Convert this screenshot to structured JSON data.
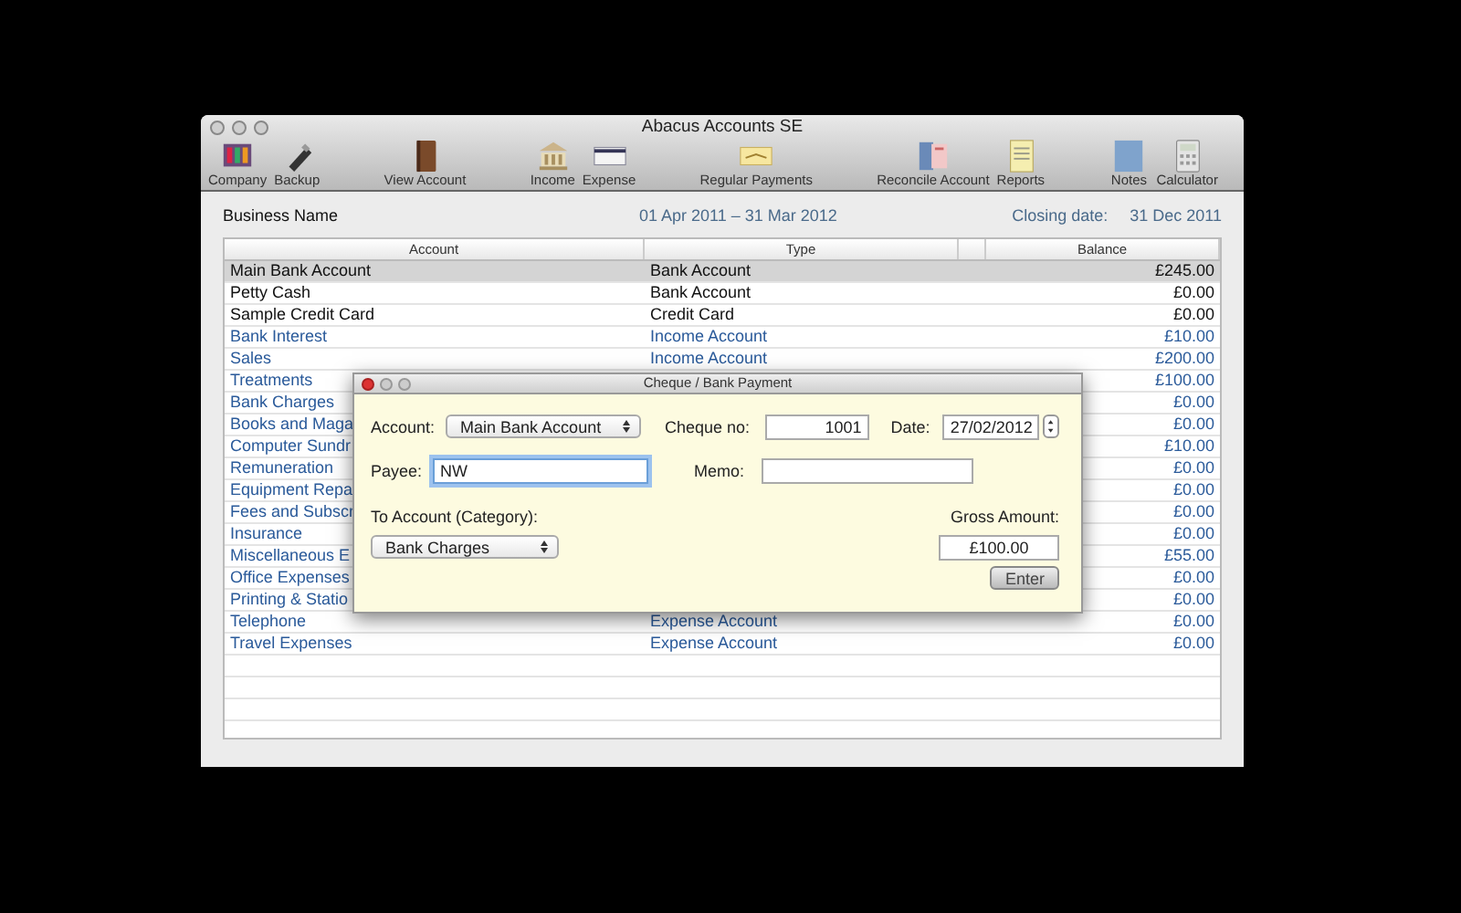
{
  "window": {
    "title": "Abacus Accounts SE"
  },
  "toolbar": [
    {
      "items": [
        "Company",
        "Backup"
      ]
    },
    {
      "items": [
        "View Account"
      ]
    },
    {
      "items": [
        "Income",
        "Expense"
      ]
    },
    {
      "items": [
        "Regular Payments"
      ]
    },
    {
      "items": [
        "Reconcile Account",
        "Reports"
      ]
    },
    {
      "items": [
        "Notes",
        "Calculator"
      ]
    }
  ],
  "header": {
    "business_name": "Business Name",
    "period": "01 Apr 2011 – 31 Mar 2012",
    "closing_label": "Closing date:",
    "closing_date": "31 Dec 2011"
  },
  "table": {
    "columns": [
      "Account",
      "Type",
      "Balance"
    ],
    "rows": [
      {
        "account": "Main Bank Account",
        "type": "Bank Account",
        "balance": "£245.00",
        "kind": "bank",
        "selected": true
      },
      {
        "account": "Petty Cash",
        "type": "Bank Account",
        "balance": "£0.00",
        "kind": "bank",
        "selected": false
      },
      {
        "account": "Sample Credit Card",
        "type": "Credit Card",
        "balance": "£0.00",
        "kind": "bank",
        "selected": false
      },
      {
        "account": "Bank Interest",
        "type": "Income Account",
        "balance": "£10.00",
        "kind": "ledger",
        "selected": false
      },
      {
        "account": "Sales",
        "type": "Income Account",
        "balance": "£200.00",
        "kind": "ledger",
        "selected": false
      },
      {
        "account": "Treatments",
        "balance": "£100.00",
        "kind": "ledger",
        "selected": false
      },
      {
        "account": "Bank Charges",
        "balance": "£0.00",
        "kind": "ledger",
        "selected": false
      },
      {
        "account": "Books and Maga",
        "balance": "£0.00",
        "kind": "ledger",
        "selected": false
      },
      {
        "account": "Computer Sundr",
        "balance": "£10.00",
        "kind": "ledger",
        "selected": false
      },
      {
        "account": "Remuneration",
        "balance": "£0.00",
        "kind": "ledger",
        "selected": false
      },
      {
        "account": "Equipment Repa",
        "balance": "£0.00",
        "kind": "ledger",
        "selected": false
      },
      {
        "account": "Fees and Subscr",
        "balance": "£0.00",
        "kind": "ledger",
        "selected": false
      },
      {
        "account": "Insurance",
        "balance": "£0.00",
        "kind": "ledger",
        "selected": false
      },
      {
        "account": "Miscellaneous E",
        "balance": "£55.00",
        "kind": "ledger",
        "selected": false
      },
      {
        "account": "Office Expenses",
        "balance": "£0.00",
        "kind": "ledger",
        "selected": false
      },
      {
        "account": "Printing & Statio",
        "balance": "£0.00",
        "kind": "ledger",
        "selected": false
      },
      {
        "account": "Telephone",
        "type": "Expense Account",
        "balance": "£0.00",
        "kind": "ledger",
        "selected": false
      },
      {
        "account": "Travel Expenses",
        "type": "Expense Account",
        "balance": "£0.00",
        "kind": "ledger",
        "selected": false
      }
    ]
  },
  "dialog": {
    "title": "Cheque / Bank Payment",
    "account_label": "Account:",
    "account": "Main Bank Account",
    "cheque_label": "Cheque no:",
    "cheque_no": "1001",
    "date_label": "Date:",
    "date": "27/02/2012",
    "payee_label": "Payee:",
    "payee": "NW",
    "payee_focused": true,
    "memo_label": "Memo:",
    "category_label": "To Account (Category):",
    "category": "Bank Charges",
    "amount_label": "Gross Amount:",
    "amount": "£100.00",
    "button": "Enter"
  }
}
